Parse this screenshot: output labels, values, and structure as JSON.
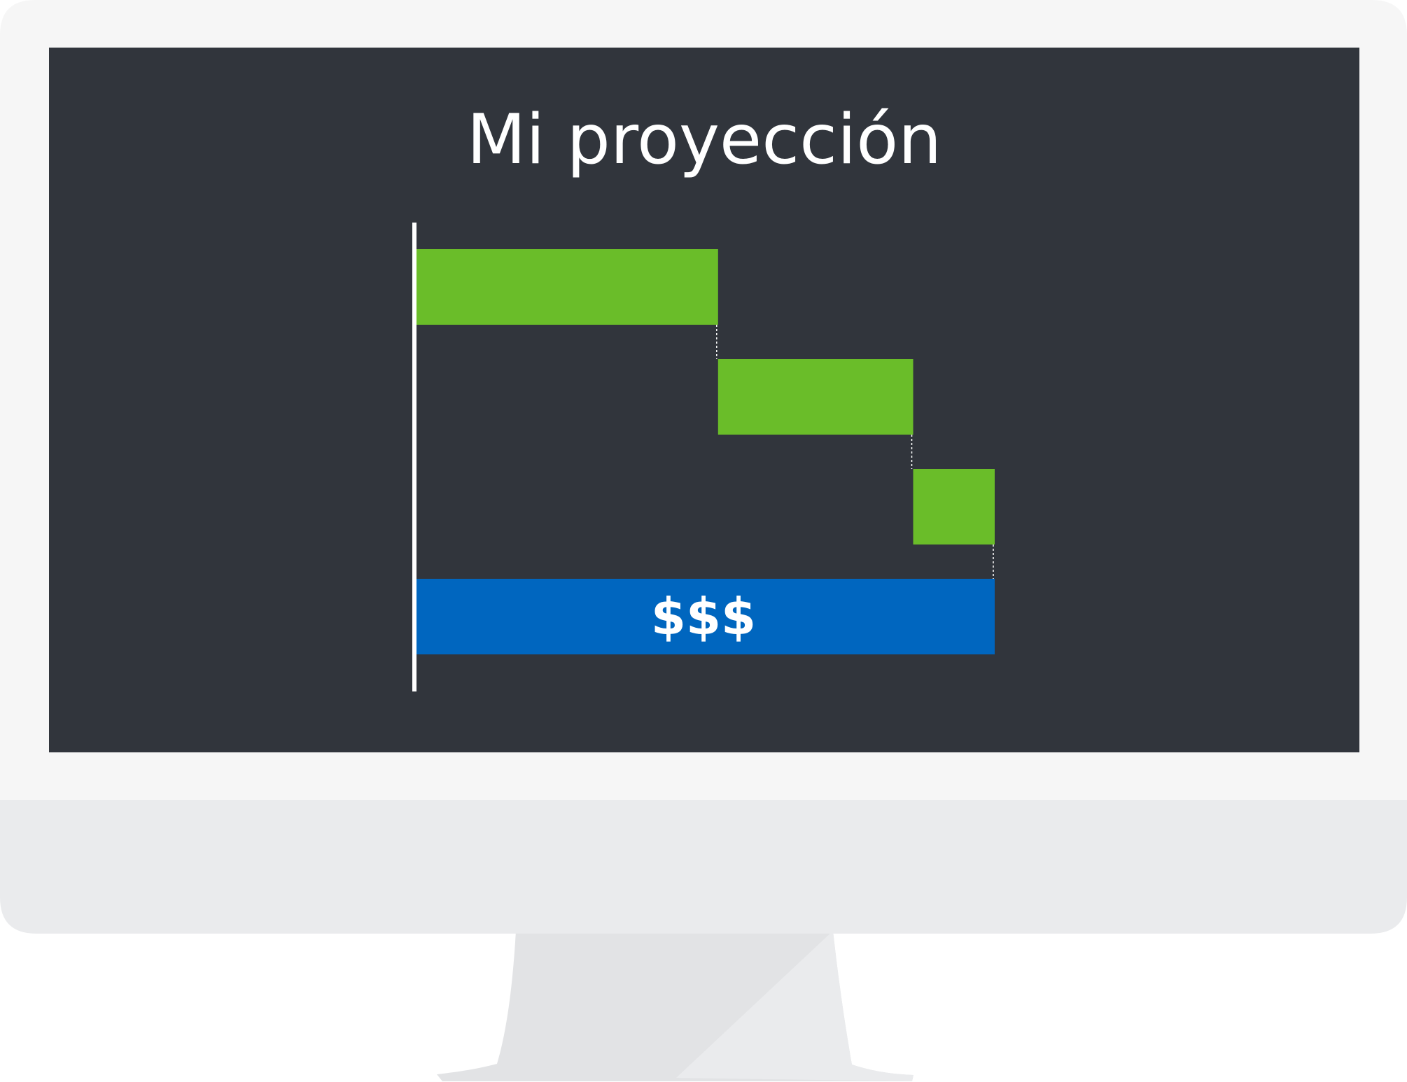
{
  "chart_data": {
    "type": "waterfall",
    "title": "Mi proyección",
    "xlabel": "",
    "ylabel": "",
    "grid": false,
    "legend": "none",
    "x_range": [
      0,
      100
    ],
    "steps": [
      {
        "start": 0,
        "value": 52.5
      },
      {
        "start": 52.5,
        "value": 33.5
      },
      {
        "start": 86,
        "value": 14
      }
    ],
    "total": {
      "value": 100,
      "label": "$$$"
    }
  },
  "colors": {
    "increase": "#6abd29",
    "total": "#0066bf",
    "screen": "#31353c",
    "bezel": "#f6f6f6",
    "chin": "#eaebed",
    "stand_dark": "#e2e3e5",
    "stand_light": "#eaebed",
    "axis": "#ffffff"
  }
}
